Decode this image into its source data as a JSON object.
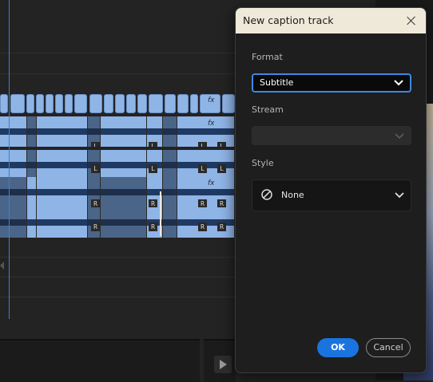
{
  "dialog": {
    "title": "New caption track",
    "format": {
      "label": "Format",
      "value": "Subtitle"
    },
    "stream": {
      "label": "Stream",
      "value": ""
    },
    "style": {
      "label": "Style",
      "value": "None"
    },
    "ok_label": "OK",
    "cancel_label": "Cancel"
  },
  "timeline": {
    "fx_label": "fx",
    "left_channel": "L",
    "right_channel": "R"
  },
  "colors": {
    "accent": "#1a74e0",
    "clip": "#8fb4e6",
    "title_bar": "#efe9d9"
  }
}
